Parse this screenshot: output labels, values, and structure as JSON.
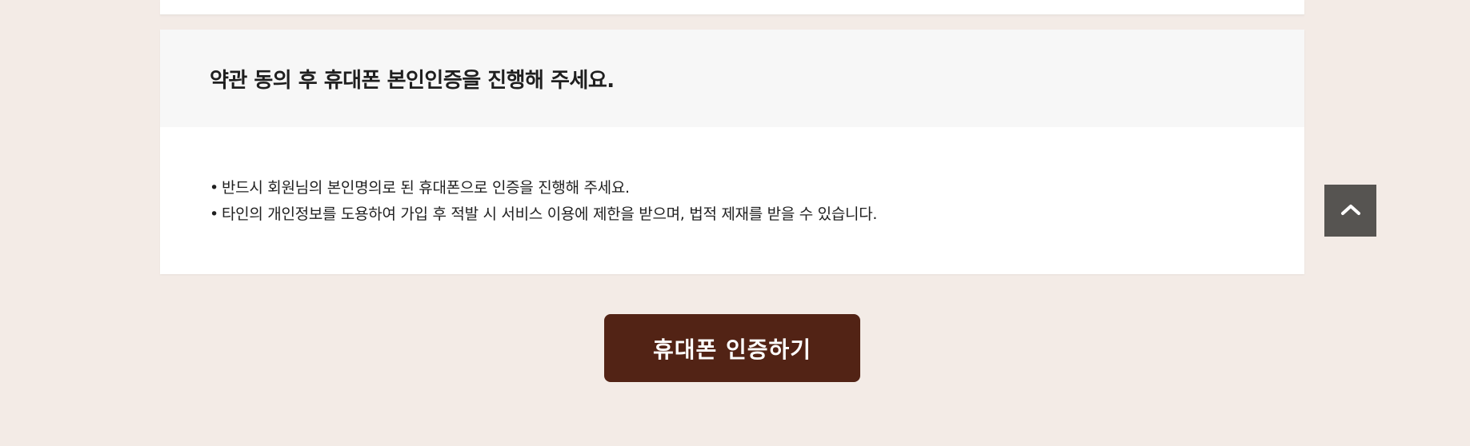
{
  "consent": {
    "title": "약관 동의 후 휴대폰 본인인증을 진행해 주세요.",
    "notices": [
      "반드시 회원님의 본인명의로 된 휴대폰으로 인증을 진행해 주세요.",
      "타인의 개인정보를 도용하여 가입 후 적발 시 서비스 이용에 제한을 받으며, 법적 제재를 받을 수 있습니다."
    ]
  },
  "actions": {
    "verify_button_label": "휴대폰 인증하기",
    "scroll_top_icon": "chevron-up-icon"
  },
  "colors": {
    "page_background": "#f3ebe6",
    "card_header_background": "#f7f7f7",
    "primary_button": "#522315",
    "scroll_top_button": "#565451"
  }
}
